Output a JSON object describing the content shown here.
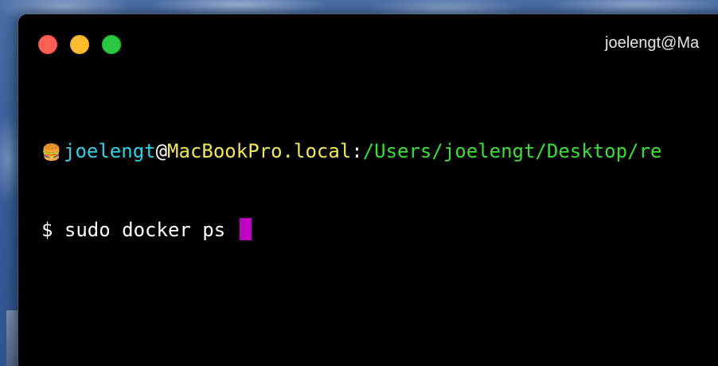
{
  "window": {
    "title": "joelengt@Ma"
  },
  "titlebar": {
    "buttons": [
      {
        "name": "close",
        "color": "#fe5f57"
      },
      {
        "name": "minimize",
        "color": "#febc2e"
      },
      {
        "name": "zoom",
        "color": "#28c840"
      }
    ]
  },
  "terminal": {
    "prompt": {
      "emoji": "🍔",
      "user": "joelengt",
      "at": "@",
      "host": "MacBookPro.local",
      "colon": ":",
      "path": "/Users/joelengt/Desktop/re"
    },
    "command_line": "$ sudo docker ps ",
    "colors": {
      "user": "#2ad2e8",
      "host": "#f3e94b",
      "path": "#33e233",
      "cursor": "#c000c8",
      "background": "#000000"
    }
  }
}
